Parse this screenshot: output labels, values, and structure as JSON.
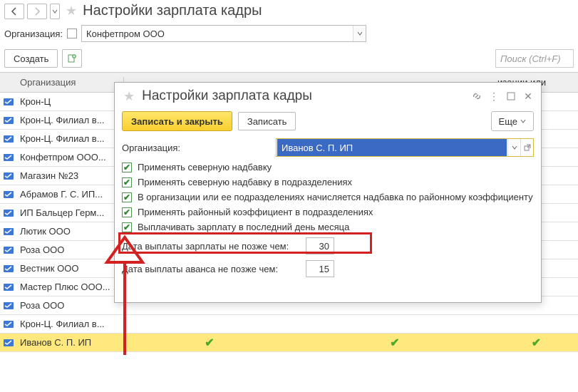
{
  "header": {
    "title": "Настройки зарплата кадры"
  },
  "filter": {
    "label": "Организация:",
    "value": "Конфетпром ООО"
  },
  "toolbar": {
    "create": "Создать",
    "search_placeholder": "Поиск (Ctrl+F)"
  },
  "table": {
    "column_org": "Организация",
    "column_other": "изации или",
    "rows": [
      {
        "name": "Крон-Ц"
      },
      {
        "name": "Крон-Ц. Филиал в..."
      },
      {
        "name": "Крон-Ц. Филиал в..."
      },
      {
        "name": "Конфетпром ООО..."
      },
      {
        "name": "Магазин №23"
      },
      {
        "name": "Абрамов Г. С. ИП..."
      },
      {
        "name": "ИП Бальцер Герм..."
      },
      {
        "name": "Лютик ООО"
      },
      {
        "name": "Роза ООО"
      },
      {
        "name": "Вестник ООО"
      },
      {
        "name": "Мастер Плюс ООО..."
      },
      {
        "name": "Роза ООО"
      },
      {
        "name": "Крон-Ц. Филиал в..."
      }
    ],
    "selected_row": {
      "name": "Иванов С. П. ИП"
    }
  },
  "modal": {
    "title": "Настройки зарплата кадры",
    "save_close": "Записать и закрыть",
    "save": "Записать",
    "more": "Еще",
    "org_label": "Организация:",
    "org_value": "Иванов С. П. ИП",
    "chk1": "Применять северную надбавку",
    "chk2": "Применять северную надбавку в подразделениях",
    "chk3": "В организации или ее подразделениях начисляется надбавка по районному коэффициенту",
    "chk4": "Применять районный коэффициент в подразделениях",
    "chk5": "Выплачивать зарплату в последний день месяца",
    "salary_label": "Дата выплаты зарплаты не позже чем:",
    "salary_value": "30",
    "advance_label": "Дата выплаты аванса не позже чем:",
    "advance_value": "15"
  }
}
